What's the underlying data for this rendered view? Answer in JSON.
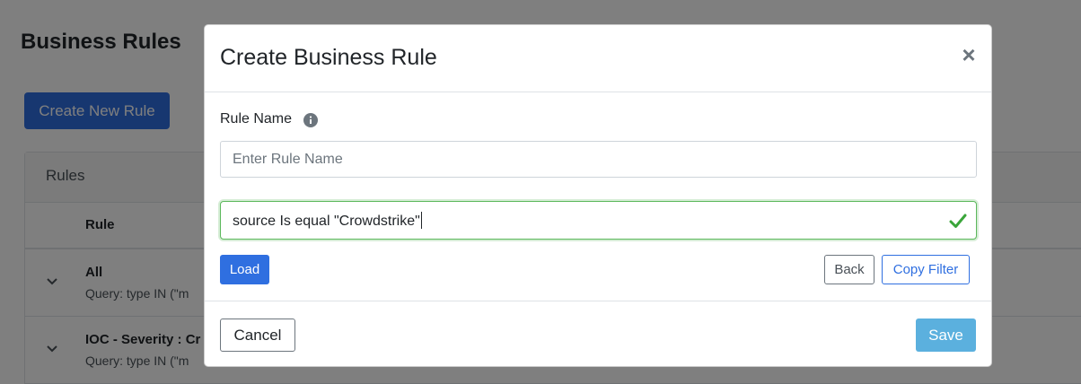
{
  "page": {
    "title": "Business Rules",
    "create_button": "Create New Rule",
    "rules_card": {
      "header": "Rules",
      "column_rule": "Rule",
      "rows": [
        {
          "title": "All",
          "query": "Query: type IN (\"m"
        },
        {
          "title": "IOC - Severity : Cr",
          "query": "Query: type IN (\"m"
        }
      ]
    }
  },
  "modal": {
    "title": "Create Business Rule",
    "close_symbol": "×",
    "rule_name_label": "Rule Name",
    "rule_name_placeholder": "Enter Rule Name",
    "rule_name_value": "",
    "filter_value": "source Is equal \"Crowdstrike\"",
    "load_label": "Load",
    "back_label": "Back",
    "copy_filter_label": "Copy Filter",
    "cancel_label": "Cancel",
    "save_label": "Save"
  },
  "colors": {
    "primary": "#2f6fe0",
    "valid_green": "#5cb85c",
    "save_info": "#5bb0de",
    "overlay": "rgba(0,0,0,0.5)"
  },
  "icons": {
    "info": "info-icon",
    "valid": "check-icon",
    "expand": "chevron-down-icon",
    "close": "close-icon"
  }
}
